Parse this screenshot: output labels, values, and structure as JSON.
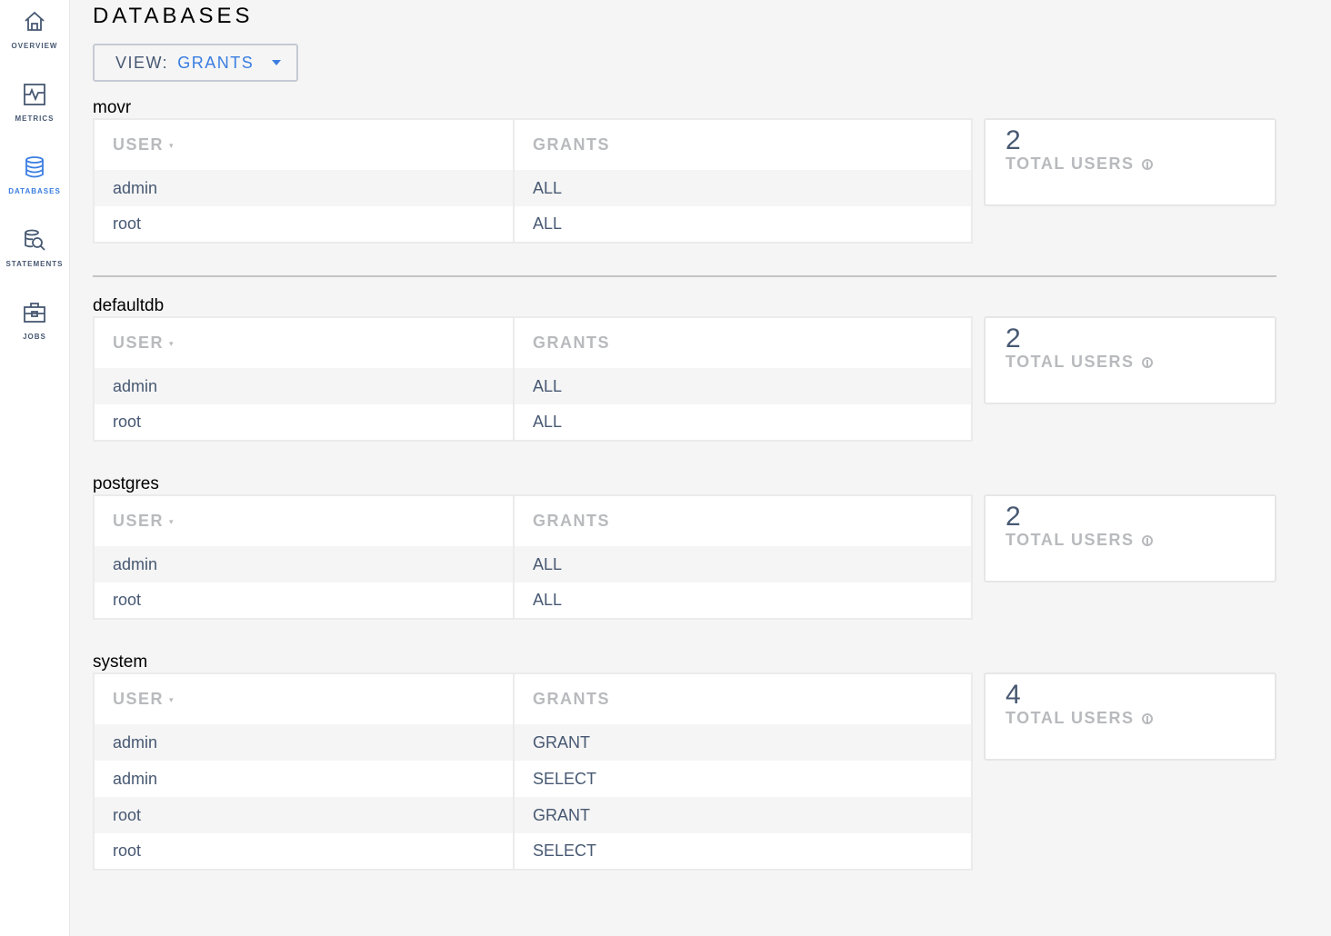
{
  "sidebar": {
    "items": [
      {
        "label": "OVERVIEW",
        "icon": "home-icon",
        "active": false
      },
      {
        "label": "METRICS",
        "icon": "metrics-chart-icon",
        "active": false
      },
      {
        "label": "DATABASES",
        "icon": "database-icon",
        "active": true
      },
      {
        "label": "STATEMENTS",
        "icon": "statements-search-icon",
        "active": false
      },
      {
        "label": "JOBS",
        "icon": "briefcase-icon",
        "active": false
      }
    ]
  },
  "header": {
    "title": "DATABASES",
    "view_label": "VIEW:",
    "view_value": "GRANTS"
  },
  "colors": {
    "accent": "#3a7de1",
    "text": "#475872",
    "muted": "#b8babd",
    "background": "#f5f5f5"
  },
  "table_headers": {
    "user": "USER",
    "grants": "GRANTS",
    "sort_indicator": "▾"
  },
  "summary_label": "TOTAL USERS",
  "databases": [
    {
      "name": "movr",
      "total_users": "2",
      "rows": [
        {
          "user": "admin",
          "grant": "ALL"
        },
        {
          "user": "root",
          "grant": "ALL"
        }
      ]
    },
    {
      "name": "defaultdb",
      "total_users": "2",
      "rows": [
        {
          "user": "admin",
          "grant": "ALL"
        },
        {
          "user": "root",
          "grant": "ALL"
        }
      ]
    },
    {
      "name": "postgres",
      "total_users": "2",
      "rows": [
        {
          "user": "admin",
          "grant": "ALL"
        },
        {
          "user": "root",
          "grant": "ALL"
        }
      ]
    },
    {
      "name": "system",
      "total_users": "4",
      "rows": [
        {
          "user": "admin",
          "grant": "GRANT"
        },
        {
          "user": "admin",
          "grant": "SELECT"
        },
        {
          "user": "root",
          "grant": "GRANT"
        },
        {
          "user": "root",
          "grant": "SELECT"
        }
      ]
    }
  ]
}
